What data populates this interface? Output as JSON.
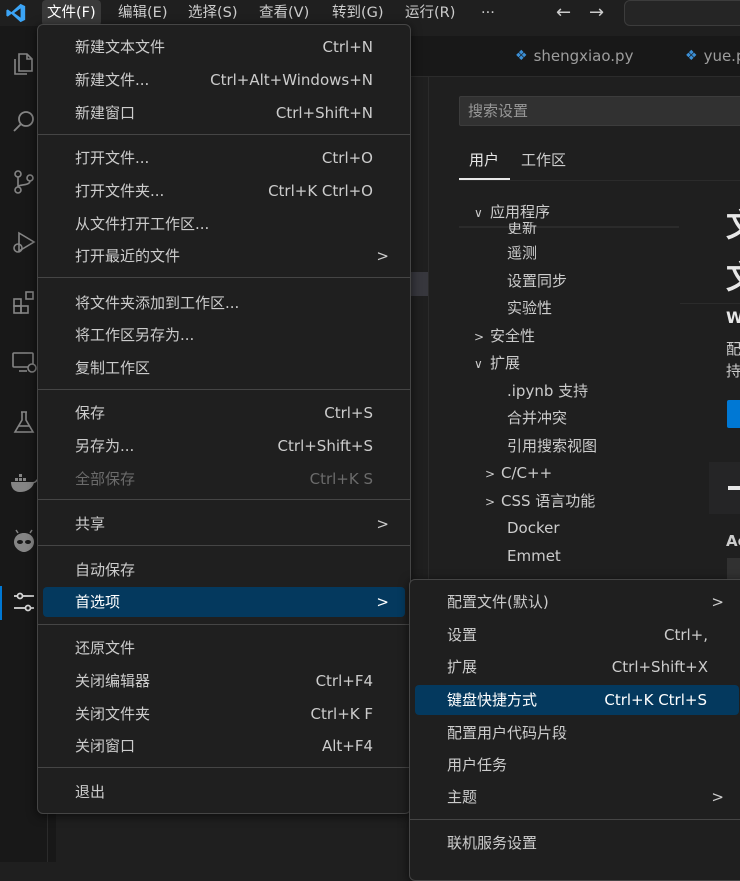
{
  "titlebar": {
    "menus": [
      "文件(F)",
      "编辑(E)",
      "选择(S)",
      "查看(V)",
      "转到(G)",
      "运行(R)",
      "···"
    ],
    "back": "←",
    "forward": "→"
  },
  "tabs": [
    {
      "label": "shengxiao.py"
    },
    {
      "label": "yue.p"
    }
  ],
  "settings": {
    "search_placeholder": "搜索设置",
    "tab_user": "用户",
    "tab_workspace": "工作区",
    "tree": {
      "app": "应用程序",
      "update_partial": "更新",
      "telemetry": "遥测",
      "settings_sync": "设置同步",
      "experimental": "实验性",
      "security": "安全性",
      "extensions": "扩展",
      "ipynb": ".ipynb 支持",
      "merge": "合并冲突",
      "refsearch": "引用搜索视图",
      "cpp": "C/C++",
      "css": "CSS 语言功能",
      "docker": "Docker",
      "emmet": "Emmet"
    },
    "big_title_1": "文",
    "big_title_2": "文",
    "snippet_w": "W",
    "snippet_pei": "配",
    "snippet_chi": "持",
    "snippet_ac": "Ac"
  },
  "file_menu": {
    "new_text": {
      "label": "新建文本文件",
      "key": "Ctrl+N"
    },
    "new_file": {
      "label": "新建文件...",
      "key": "Ctrl+Alt+Windows+N"
    },
    "new_window": {
      "label": "新建窗口",
      "key": "Ctrl+Shift+N"
    },
    "open_file": {
      "label": "打开文件...",
      "key": "Ctrl+O"
    },
    "open_folder": {
      "label": "打开文件夹...",
      "key": "Ctrl+K Ctrl+O"
    },
    "open_workspace": {
      "label": "从文件打开工作区..."
    },
    "open_recent": {
      "label": "打开最近的文件"
    },
    "add_folder": {
      "label": "将文件夹添加到工作区..."
    },
    "save_workspace_as": {
      "label": "将工作区另存为..."
    },
    "duplicate_workspace": {
      "label": "复制工作区"
    },
    "save": {
      "label": "保存",
      "key": "Ctrl+S"
    },
    "save_as": {
      "label": "另存为...",
      "key": "Ctrl+Shift+S"
    },
    "save_all": {
      "label": "全部保存",
      "key": "Ctrl+K S"
    },
    "share": {
      "label": "共享"
    },
    "auto_save": {
      "label": "自动保存"
    },
    "preferences": {
      "label": "首选项"
    },
    "revert": {
      "label": "还原文件"
    },
    "close_editor": {
      "label": "关闭编辑器",
      "key": "Ctrl+F4"
    },
    "close_folder": {
      "label": "关闭文件夹",
      "key": "Ctrl+K F"
    },
    "close_window": {
      "label": "关闭窗口",
      "key": "Alt+F4"
    },
    "exit": {
      "label": "退出"
    }
  },
  "prefs_menu": {
    "profile": {
      "label": "配置文件(默认)"
    },
    "settings": {
      "label": "设置",
      "key": "Ctrl+,"
    },
    "extensions": {
      "label": "扩展",
      "key": "Ctrl+Shift+X"
    },
    "keybindings": {
      "label": "键盘快捷方式",
      "key": "Ctrl+K Ctrl+S"
    },
    "snippets": {
      "label": "配置用户代码片段"
    },
    "tasks": {
      "label": "用户任务"
    },
    "theme": {
      "label": "主题"
    },
    "online": {
      "label": "联机服务设置"
    }
  },
  "colors": {
    "accent": "#0078d4",
    "selection": "#04395e",
    "vscode_logo": "#3ba4f6"
  }
}
